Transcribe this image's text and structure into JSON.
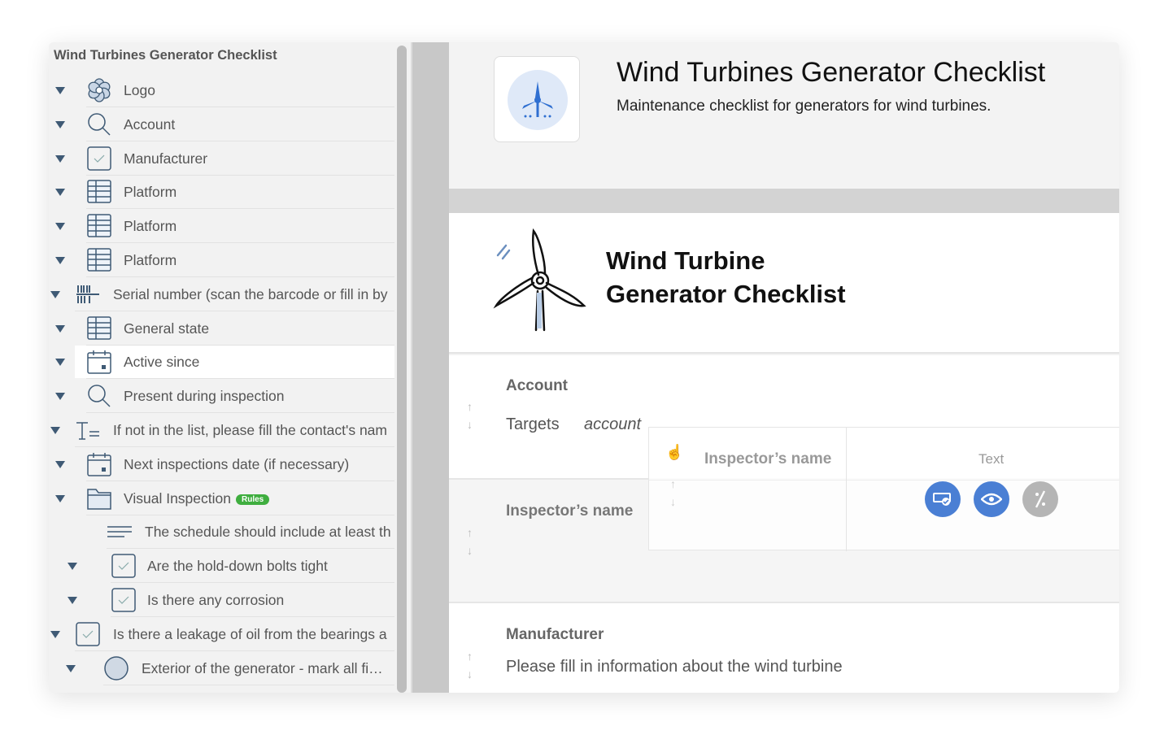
{
  "sidebar": {
    "title": "Wind Turbines Generator Checklist",
    "items": [
      {
        "label": "Logo",
        "icon": "flower-icon"
      },
      {
        "label": "Account",
        "icon": "search-icon"
      },
      {
        "label": "Manufacturer",
        "icon": "checkbox-icon"
      },
      {
        "label": "Platform",
        "icon": "table-icon"
      },
      {
        "label": "Platform",
        "icon": "table-icon"
      },
      {
        "label": "Platform",
        "icon": "table-icon"
      },
      {
        "label": "Serial number (scan the barcode or fill in by",
        "icon": "barcode-icon"
      },
      {
        "label": "General state",
        "icon": "table-icon"
      },
      {
        "label": "Active since",
        "icon": "calendar-icon",
        "selected": true
      },
      {
        "label": "Present during inspection",
        "icon": "search-icon"
      },
      {
        "label": "If not in the list, please fill the contact's nam",
        "icon": "text-field-icon"
      },
      {
        "label": "Next inspections date (if necessary)",
        "icon": "calendar-icon"
      },
      {
        "label": "Visual Inspection",
        "icon": "folder-icon",
        "badge": "Rules"
      },
      {
        "label": "The schedule should include at least th",
        "icon": "paragraph-icon"
      },
      {
        "label": "Are the hold-down bolts tight",
        "icon": "checkbox-icon"
      },
      {
        "label": "Is there any corrosion",
        "icon": "checkbox-icon"
      },
      {
        "label": "Is there a leakage of oil from the bearings a",
        "icon": "checkbox-icon"
      },
      {
        "label": "Exterior of the generator - mark all fi…",
        "icon": "radio-icon"
      }
    ]
  },
  "header": {
    "title": "Wind Turbines Generator Checklist",
    "subtitle": "Maintenance checklist for generators for wind turbines."
  },
  "card": {
    "title_line1": "Wind Turbine",
    "title_line2": "Generator Checklist"
  },
  "sections": {
    "account": {
      "label": "Account",
      "targets_label": "Targets",
      "targets_value": "account"
    },
    "inspector": {
      "label": "Inspector’s name"
    },
    "manufacturer": {
      "label": "Manufacturer",
      "description": "Please fill in information about the wind turbine"
    }
  },
  "drag_preview": {
    "label": "Inspector’s name",
    "type": "Text",
    "buttons": [
      "validation-icon",
      "visibility-icon",
      "disabled-icon"
    ]
  },
  "colors": {
    "accent": "#4a7fd4",
    "icon": "#3f5a75",
    "badge": "#3fae3f",
    "disabled": "#b5b5b5"
  }
}
